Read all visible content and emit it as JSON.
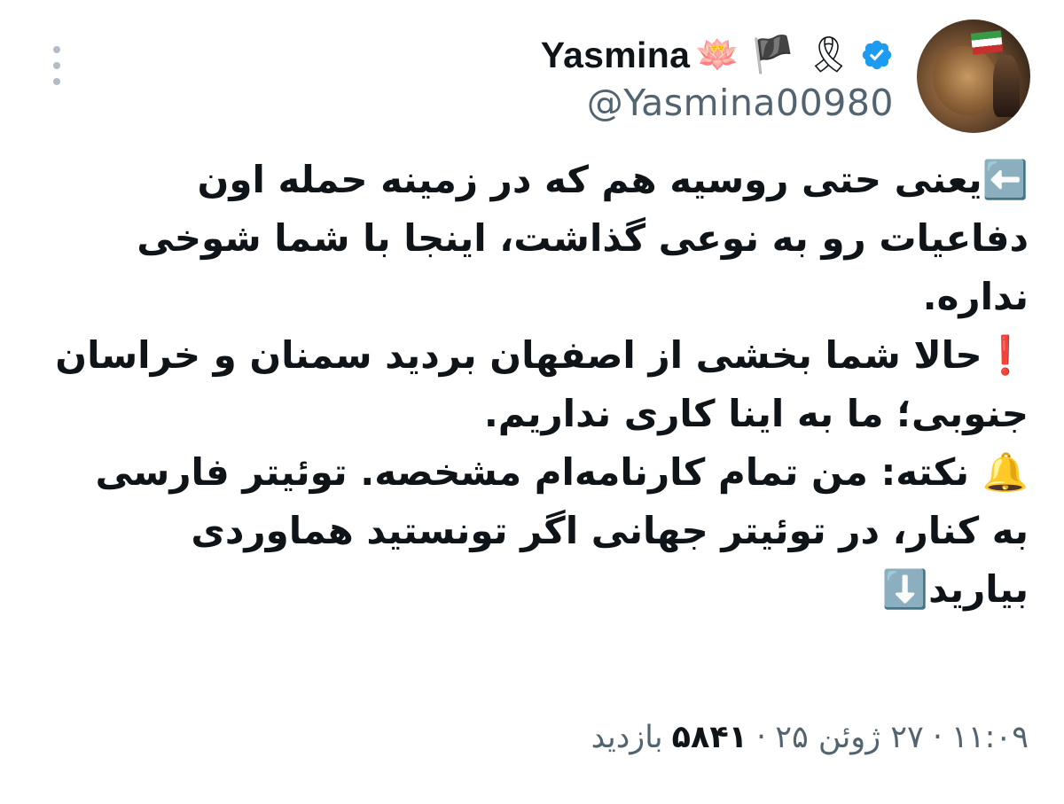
{
  "author": {
    "display_name": "Yasmina",
    "name_emojis": "🪷 🏴 🎗",
    "handle": "@Yasmina00980"
  },
  "tweet": {
    "lines": [
      "⬅️یعنی حتی روسیه هم که در زمینه حمله اون دفاعیات رو به نوعی گذاشت، اینجا با شما شوخی نداره.",
      "❗️حالا شما بخشی از اصفهان بردید سمنان و خراسان جنوبی؛ ما به اینا کاری نداریم.",
      "🔔 نکته: من تمام کارنامه‌ام مشخصه. توئیتر فارسی به کنار، در توئیتر جهانی اگر تونستید هماوردی بیارید⬇️"
    ]
  },
  "meta": {
    "time": "۱۱:۰۹",
    "date": "۲۷ ژوئن ۲۵",
    "separator": "·",
    "views_count": "۵۸۴۱",
    "views_label": "بازدید"
  },
  "colors": {
    "verified": "#1d9bf0",
    "secondary_text": "#536471",
    "primary_text": "#0f1419"
  }
}
